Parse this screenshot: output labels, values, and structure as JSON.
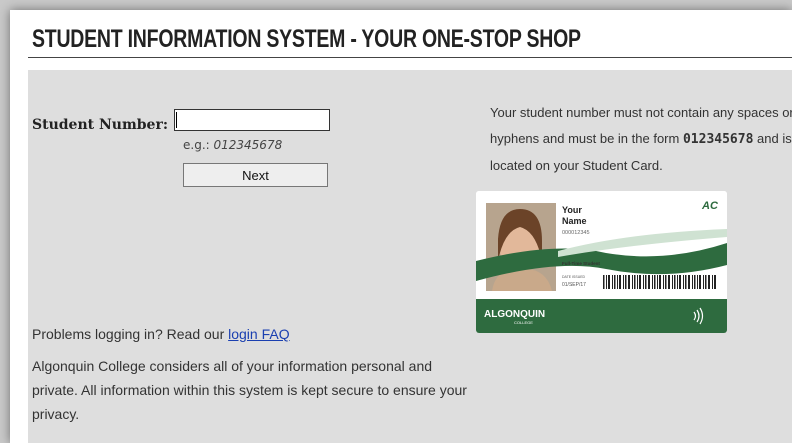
{
  "header": {
    "title": "STUDENT INFORMATION SYSTEM - YOUR ONE-STOP SHOP"
  },
  "login": {
    "student_number_label": "Student Number:",
    "student_number_value": "",
    "example_prefix": "e.g.:",
    "example_value": "012345678",
    "next_label": "Next"
  },
  "info": {
    "text_before": "Your student number must not contain any spaces or hyphens and must be in the form",
    "format_example": "012345678",
    "text_after": "and is located on your Student Card."
  },
  "card": {
    "name_line1": "Your",
    "name_line2": "Name",
    "number": "000012345",
    "status": "Full-Time Student",
    "date_label": "DATE ISSUED",
    "date_value": "01/SEP/17",
    "logo_text": "ALGONQUIN",
    "logo_sub": "COLLEGE",
    "corner_logo": "AC",
    "green": "#2e6b3f"
  },
  "help": {
    "problems_text": "Problems logging in? Read our",
    "faq_link": "login FAQ",
    "privacy_text": "Algonquin College considers all of your information personal and private. All information within this system is kept secure to ensure your privacy."
  }
}
